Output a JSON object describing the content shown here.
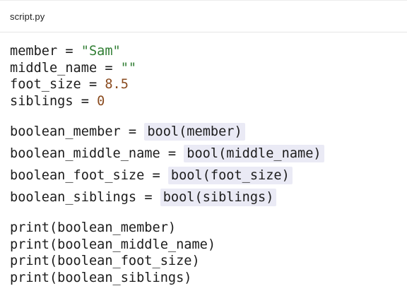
{
  "tab": {
    "filename": "script.py"
  },
  "code": {
    "block1": [
      {
        "var": "member",
        "op": " = ",
        "value": "\"Sam\"",
        "kind": "str"
      },
      {
        "var": "middle_name",
        "op": " = ",
        "value": "\"\"",
        "kind": "str"
      },
      {
        "var": "foot_size",
        "op": " = ",
        "value": "8.5",
        "kind": "num"
      },
      {
        "var": "siblings",
        "op": " = ",
        "value": "0",
        "kind": "num"
      }
    ],
    "block2": [
      {
        "var": "boolean_member",
        "op": " = ",
        "expr": "bool(member)"
      },
      {
        "var": "boolean_middle_name",
        "op": " = ",
        "expr": "bool(middle_name)"
      },
      {
        "var": "boolean_foot_size",
        "op": " = ",
        "expr": "bool(foot_size)"
      },
      {
        "var": "boolean_siblings",
        "op": " = ",
        "expr": "bool(siblings)"
      }
    ],
    "block3": [
      "print(boolean_member)",
      "print(boolean_middle_name)",
      "print(boolean_foot_size)",
      "print(boolean_siblings)"
    ]
  },
  "colors": {
    "string": "#2f7d32",
    "number": "#8a4b1f",
    "highlight": "#eaeaf5"
  }
}
